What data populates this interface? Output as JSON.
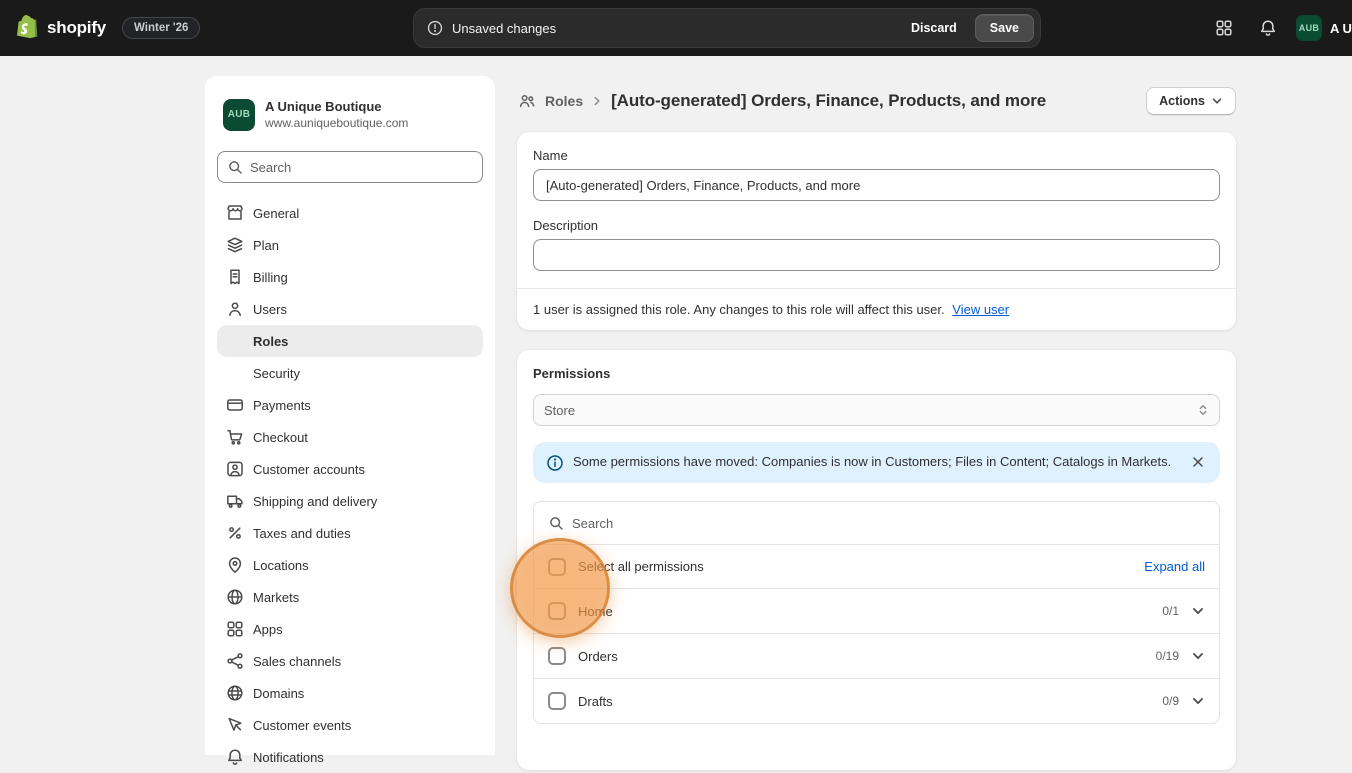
{
  "topbar": {
    "brand": "shopify",
    "edition_badge": "Winter '26",
    "status": "Unsaved changes",
    "discard_label": "Discard",
    "save_label": "Save",
    "account_initials": "AUB",
    "account_name": "A U"
  },
  "sidebar": {
    "store_initials": "AUB",
    "store_name": "A Unique Boutique",
    "store_url": "www.auniqueboutique.com",
    "search_placeholder": "Search",
    "items": [
      {
        "label": "General",
        "icon": "store-icon"
      },
      {
        "label": "Plan",
        "icon": "plan-icon"
      },
      {
        "label": "Billing",
        "icon": "billing-icon"
      },
      {
        "label": "Users",
        "icon": "users-icon"
      },
      {
        "label": "Roles",
        "icon": "none",
        "selected": true
      },
      {
        "label": "Security",
        "icon": "none"
      },
      {
        "label": "Payments",
        "icon": "payments-icon"
      },
      {
        "label": "Checkout",
        "icon": "checkout-icon"
      },
      {
        "label": "Customer accounts",
        "icon": "customer-accounts-icon"
      },
      {
        "label": "Shipping and delivery",
        "icon": "shipping-icon"
      },
      {
        "label": "Taxes and duties",
        "icon": "taxes-icon"
      },
      {
        "label": "Locations",
        "icon": "locations-icon"
      },
      {
        "label": "Markets",
        "icon": "markets-icon"
      },
      {
        "label": "Apps",
        "icon": "apps-icon"
      },
      {
        "label": "Sales channels",
        "icon": "sales-channels-icon"
      },
      {
        "label": "Domains",
        "icon": "domains-icon"
      },
      {
        "label": "Customer events",
        "icon": "customer-events-icon"
      },
      {
        "label": "Notifications",
        "icon": "notifications-icon"
      }
    ]
  },
  "main": {
    "breadcrumb": {
      "section": "Roles",
      "title": "[Auto-generated] Orders, Finance, Products, and more"
    },
    "actions_label": "Actions",
    "name_card": {
      "name_label": "Name",
      "name_value": "[Auto-generated] Orders, Finance, Products, and more",
      "description_label": "Description",
      "description_value": "",
      "assignment_text": "1 user is assigned this role. Any changes to this role will affect this user.",
      "view_user_label": "View user"
    },
    "permissions": {
      "title": "Permissions",
      "scope_value": "Store",
      "banner_text": "Some permissions have moved: Companies is now in Customers; Files in Content; Catalogs in Markets.",
      "search_placeholder": "Search",
      "select_all_label": "Select all permissions",
      "expand_all_label": "Expand all",
      "groups": [
        {
          "label": "Home",
          "count": "0/1"
        },
        {
          "label": "Orders",
          "count": "0/19"
        },
        {
          "label": "Drafts",
          "count": "0/9"
        }
      ]
    }
  },
  "icons": {
    "search-icon": "magnifier",
    "chevron-down-icon": "v",
    "chevron-right-icon": ">",
    "select-updown-icon": "updown-carets",
    "info-icon": "circle-i",
    "close-icon": "x",
    "unsaved-changes-icon": "circle-alert",
    "notifications-icon": "bell",
    "apps-icon": "grid"
  },
  "colors": {
    "topbar_bg": "#1a1a1a",
    "page_bg": "#f1f1f1",
    "link": "#005bd3",
    "banner_bg": "#dff1ff",
    "brand_green": "#95bf47",
    "avatar_green": "#0c4b33",
    "click_highlight": "#f09443"
  }
}
